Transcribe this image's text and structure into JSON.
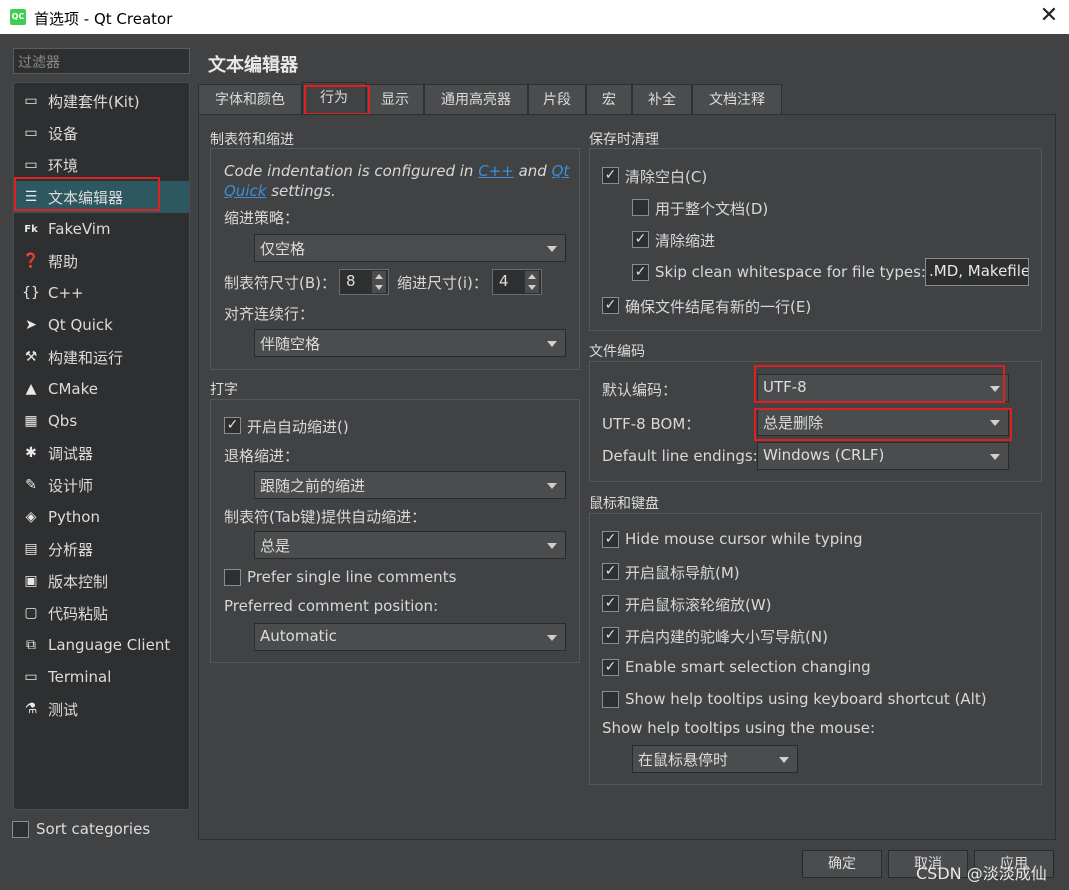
{
  "window": {
    "title": "首选项 - Qt Creator",
    "logo_text": "QC"
  },
  "filter_placeholder": "过滤器",
  "sidebar": {
    "items": [
      {
        "label": "构建套件(Kit)",
        "icon": "monitor-icon"
      },
      {
        "label": "设备",
        "icon": "monitor-icon"
      },
      {
        "label": "环境",
        "icon": "monitor-icon"
      },
      {
        "label": "文本编辑器",
        "icon": "text-editor-icon"
      },
      {
        "label": "FakeVim",
        "icon": "fakevim-icon"
      },
      {
        "label": "帮助",
        "icon": "help-icon"
      },
      {
        "label": "C++",
        "icon": "braces-icon"
      },
      {
        "label": "Qt Quick",
        "icon": "qtquick-icon"
      },
      {
        "label": "构建和运行",
        "icon": "hammer-icon"
      },
      {
        "label": "CMake",
        "icon": "cmake-icon"
      },
      {
        "label": "Qbs",
        "icon": "qbs-icon"
      },
      {
        "label": "调试器",
        "icon": "bug-icon"
      },
      {
        "label": "设计师",
        "icon": "pen-icon"
      },
      {
        "label": "Python",
        "icon": "python-icon"
      },
      {
        "label": "分析器",
        "icon": "analyzer-icon"
      },
      {
        "label": "版本控制",
        "icon": "version-control-icon"
      },
      {
        "label": "代码粘贴",
        "icon": "paste-icon"
      },
      {
        "label": "Language Client",
        "icon": "language-client-icon"
      },
      {
        "label": "Terminal",
        "icon": "terminal-icon"
      },
      {
        "label": "测试",
        "icon": "test-icon"
      }
    ],
    "sort_label": "Sort categories"
  },
  "page_title": "文本编辑器",
  "tabs": [
    "字体和颜色",
    "行为",
    "显示",
    "通用高亮器",
    "片段",
    "宏",
    "补全",
    "文档注释"
  ],
  "tabs_indent": {
    "title": "制表符和缩进",
    "info_prefix": "Code indentation is configured in ",
    "link_cpp": "C++",
    "info_and": " and ",
    "link_qtquick_1": "Qt",
    "link_qtquick_2": "Quick",
    "info_suffix": " settings.",
    "policy_label": "缩进策略：",
    "policy_value": "仅空格",
    "tab_size_label": "制表符尺寸(B)：",
    "tab_size_value": "8",
    "indent_size_label": "缩进尺寸(i)：",
    "indent_size_value": "4",
    "align_label": "对齐连续行：",
    "align_value": "伴随空格"
  },
  "typing": {
    "title": "打字",
    "auto_indent_label": "开启自动缩进()",
    "backspace_label": "退格缩进：",
    "backspace_value": "跟随之前的缩进",
    "tab_auto_label": "制表符(Tab键)提供自动缩进：",
    "tab_auto_value": "总是",
    "single_line_label": "Prefer single line comments",
    "comment_pos_label": "Preferred comment position:",
    "comment_pos_value": "Automatic"
  },
  "cleanup": {
    "title": "保存时清理",
    "clean_ws": "清除空白(C)",
    "whole_doc": "用于整个文档(D)",
    "clean_indent": "清除缩进",
    "skip_label": "Skip clean whitespace for file types:",
    "skip_value": ".MD, Makefile",
    "ensure_newline": "确保文件结尾有新的一行(E)"
  },
  "encoding": {
    "title": "文件编码",
    "default_label": "默认编码：",
    "default_value": "UTF-8",
    "bom_label": "UTF-8 BOM：",
    "bom_value": "总是删除",
    "line_endings_label": "Default line endings:",
    "line_endings_value": "Windows (CRLF)"
  },
  "mouse": {
    "title": "鼠标和键盘",
    "hide_cursor": "Hide mouse cursor while typing",
    "mouse_nav": "开启鼠标导航(M)",
    "wheel_zoom": "开启鼠标滚轮缩放(W)",
    "camel_nav": "开启内建的驼峰大小写导航(N)",
    "smart_sel": "Enable smart selection changing",
    "help_tooltips_kb": "Show help tooltips using keyboard shortcut (Alt)",
    "help_tooltips_mouse_label": "Show help tooltips using the mouse:",
    "help_tooltips_mouse_value": "在鼠标悬停时"
  },
  "buttons": {
    "ok": "确定",
    "cancel": "取消",
    "apply": "应用"
  },
  "watermark": "CSDN @淡淡成仙",
  "colors": {
    "accent": "#2e5860",
    "highlight_box": "#e02020",
    "link": "#3d8fdb"
  }
}
